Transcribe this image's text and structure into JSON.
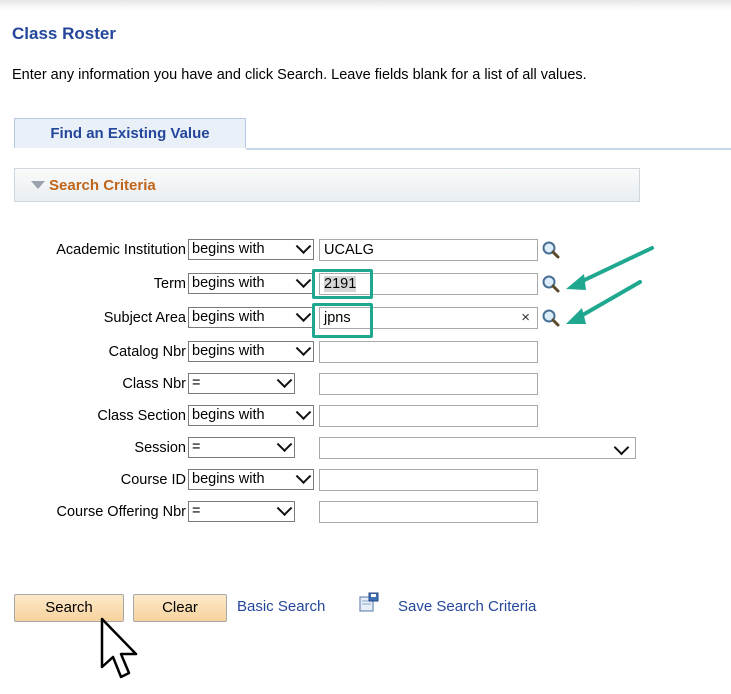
{
  "page": {
    "title": "Class Roster",
    "instructions": "Enter any information you have and click Search. Leave fields blank for a list of all values."
  },
  "tab": {
    "label": "Find an Existing Value"
  },
  "criteria": {
    "header": "Search Criteria",
    "fields": [
      {
        "label": "Academic Institution",
        "operator": "begins with",
        "value": "UCALG"
      },
      {
        "label": "Term",
        "operator": "begins with",
        "value": "2191"
      },
      {
        "label": "Subject Area",
        "operator": "begins with",
        "value": "jpns"
      },
      {
        "label": "Catalog Nbr",
        "operator": "begins with",
        "value": ""
      },
      {
        "label": "Class Nbr",
        "operator": "=",
        "value": ""
      },
      {
        "label": "Class Section",
        "operator": "begins with",
        "value": ""
      },
      {
        "label": "Session",
        "operator": "=",
        "value": ""
      },
      {
        "label": "Course ID",
        "operator": "begins with",
        "value": ""
      },
      {
        "label": "Course Offering Nbr",
        "operator": "=",
        "value": ""
      }
    ]
  },
  "actions": {
    "search_label": "Search",
    "clear_label": "Clear",
    "basic_search_label": "Basic Search",
    "save_search_label": "Save Search Criteria"
  },
  "icons": {
    "lookup": "magnifier-icon",
    "save_search": "save-search-icon",
    "cursor": "pointer-cursor-icon",
    "annotation": "arrow-annotation"
  },
  "colors": {
    "title": "#24479b",
    "criteria_header": "#c0651a",
    "highlight": "#1fa88f",
    "button_fill": "#f6d39d"
  }
}
